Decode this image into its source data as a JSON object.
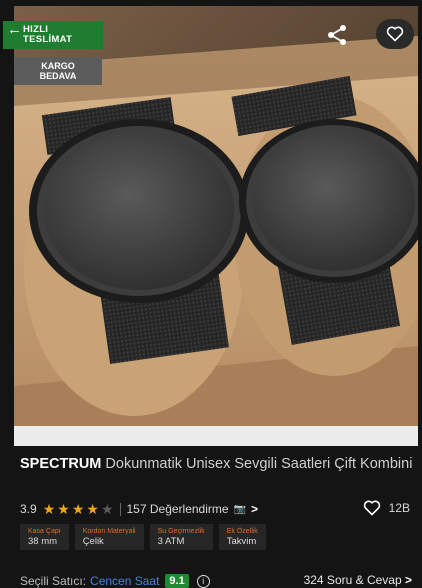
{
  "badges": {
    "fast_delivery": [
      "HIZLI",
      "TESLİMAT"
    ],
    "free_cargo": [
      "KARGO",
      "BEDAVA"
    ]
  },
  "icons": {
    "back": "arrow-left-icon",
    "share": "share-icon",
    "favorite": "heart-icon"
  },
  "product": {
    "brand": "SPECTRUM",
    "name": "Dokunmatik Unisex Sevgili Saatleri Çift Kombini",
    "rating": "3.9",
    "rating_value": 3.9,
    "reviews_label": "157 Değerlendirme",
    "likes": "12B"
  },
  "specs": [
    {
      "key": "Kasa Çapı",
      "value": "38 mm"
    },
    {
      "key": "Kordon Materyali",
      "value": "Çelik"
    },
    {
      "key": "Su Geçirmezlik",
      "value": "3 ATM"
    },
    {
      "key": "Ek Özellik",
      "value": "Takvim"
    }
  ],
  "seller": {
    "label": "Seçili Satıcı:",
    "name": "Cencen Saat",
    "score": "9.1"
  },
  "qa_label": "324 Soru & Cevap",
  "colors": {
    "accent_orange": "#e2692a",
    "star": "#f1a51a",
    "green": "#1e7d2e",
    "link_blue": "#4a82d8"
  }
}
